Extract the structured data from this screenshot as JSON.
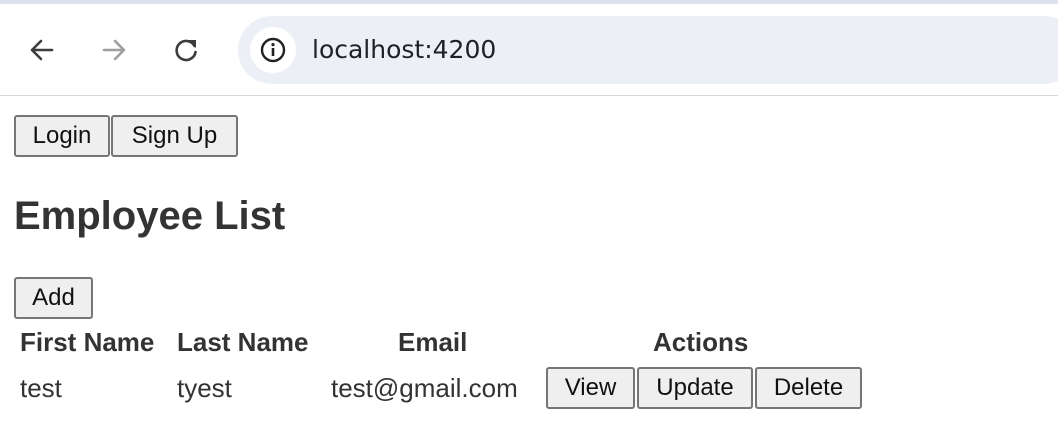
{
  "browser": {
    "url": "localhost:4200",
    "back_icon": "arrow-left-icon",
    "forward_icon": "arrow-right-icon",
    "reload_icon": "reload-icon",
    "site_info_icon": "info-icon"
  },
  "header_buttons": {
    "login_label": "Login",
    "signup_label": "Sign Up"
  },
  "main": {
    "title": "Employee List",
    "add_label": "Add",
    "columns": [
      "First Name",
      "Last Name",
      "Email",
      "Actions"
    ],
    "rows": [
      {
        "first_name": "test",
        "last_name": "tyest",
        "email": "test@gmail.com",
        "actions": [
          "View",
          "Update",
          "Delete"
        ]
      }
    ]
  },
  "colors": {
    "text": "#333333",
    "button_bg": "#efefef",
    "button_border": "#767676",
    "omnibox_bg": "#eceff5",
    "top_strip": "#dde3ee"
  }
}
